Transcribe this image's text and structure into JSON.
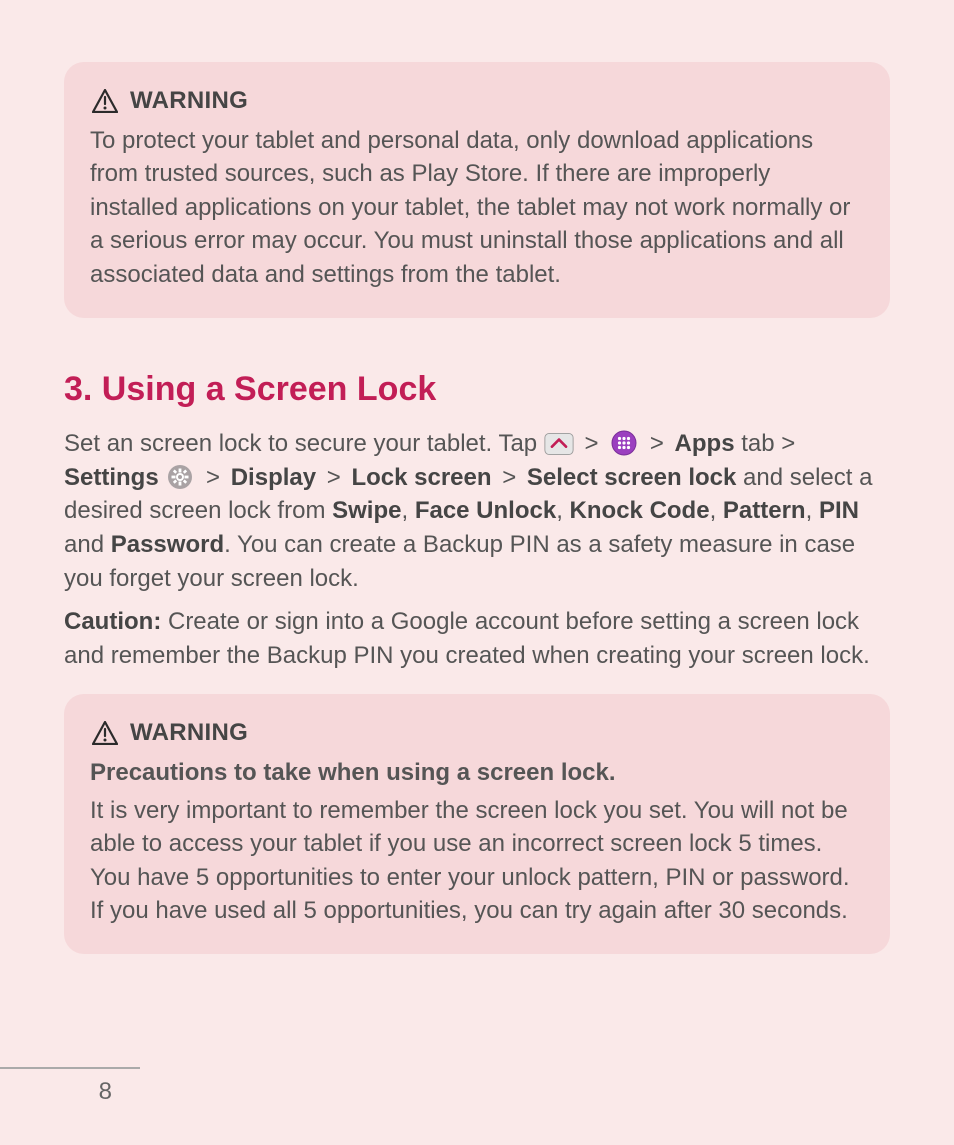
{
  "warning1": {
    "title": "WARNING",
    "body": "To protect your tablet and personal data, only download applications from trusted sources, such as Play Store. If there are improperly installed applications on your tablet, the tablet may not work normally or a serious error may occur. You must uninstall those applications and all associated data and settings from the tablet."
  },
  "section": {
    "heading": "3. Using a Screen Lock",
    "intro_prefix": "Set an screen lock to secure your tablet. Tap ",
    "sep": " > ",
    "apps_bold": "Apps",
    "apps_suffix": " tab > ",
    "settings_bold": "Settings",
    "gear_sep_after": " > ",
    "display_bold": "Display",
    "lockscreen_bold": "Lock screen",
    "selectlock_bold": "Select screen lock",
    "after_select": " and select a desired screen lock from ",
    "swipe": "Swipe",
    "comma": ", ",
    "faceunlock": "Face Unlock",
    "knock": "Knock Code",
    "pattern": "Pattern",
    "pin": "PIN",
    "and": " and ",
    "password": "Password",
    "tail": ". You can create a Backup PIN as a safety measure in case you forget your screen lock.",
    "caution_label": "Caution:",
    "caution_body": " Create or sign into a Google account before setting a screen lock and remember the Backup PIN you created when creating your screen lock."
  },
  "warning2": {
    "title": "WARNING",
    "subtitle": "Precautions to take when using a screen lock.",
    "body": "It is very important to remember the screen lock you set. You will not be able to access your tablet if you use an incorrect screen lock 5 times. You have 5 opportunities to enter your unlock pattern, PIN or password. If you have used all 5 opportunities, you can try again after 30 seconds."
  },
  "page_number": "8"
}
